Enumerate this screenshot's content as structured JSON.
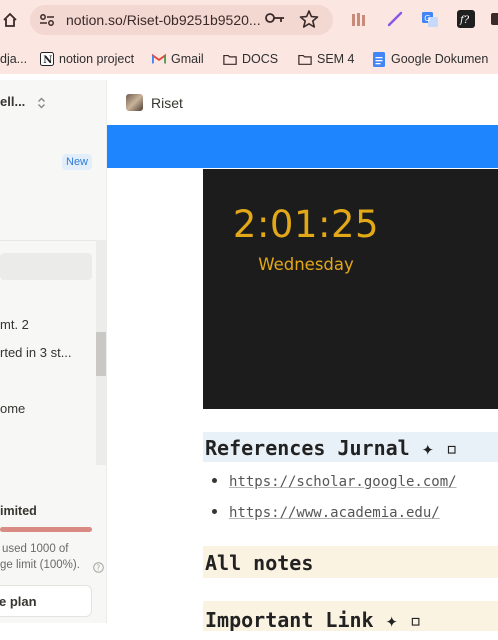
{
  "browser": {
    "url": "notion.so/Riset-0b9251b9520...",
    "bookmarks": [
      {
        "label": "dja...",
        "icon": "generic-favicon"
      },
      {
        "label": "notion project",
        "icon": "notion-icon"
      },
      {
        "label": "Gmail",
        "icon": "gmail-icon"
      },
      {
        "label": "DOCS",
        "icon": "folder-icon"
      },
      {
        "label": "SEM 4",
        "icon": "folder-icon"
      },
      {
        "label": "Google Dokumen",
        "icon": "google-docs-icon"
      }
    ],
    "extensions": [
      "bars-extension-icon",
      "pen-extension-icon",
      "translate-extension-icon",
      "function-extension-icon",
      "extension-icon"
    ],
    "ext_fn_label": "f?"
  },
  "sidebar": {
    "workspace_name": "ell...",
    "new_badge": "New",
    "items": [
      "mt. 2",
      "rted in 3 st...",
      "ome"
    ],
    "limit_title": "imited",
    "limit_text_1": "used 1000 of",
    "limit_text_2": "ge limit (100%).",
    "upgrade_label": "e plan"
  },
  "page": {
    "breadcrumb_title": "Riset",
    "clock": {
      "time": "2:01:25",
      "day": "Wednesday"
    },
    "references_heading": "References Jurnal ✦ ▫",
    "links": [
      "https://scholar.google.com/",
      "https://www.academia.edu/"
    ],
    "all_notes_heading": "All notes",
    "important_heading": "Important Link ✦ ▫"
  },
  "colors": {
    "chrome_bg": "#fbe6e2",
    "banner_blue": "#1e85ff",
    "clock_gold": "#e3a817",
    "clock_bg": "#1c1c1c",
    "callout_blue": "#e8f1f8",
    "callout_yellow": "#fbf3e2"
  }
}
